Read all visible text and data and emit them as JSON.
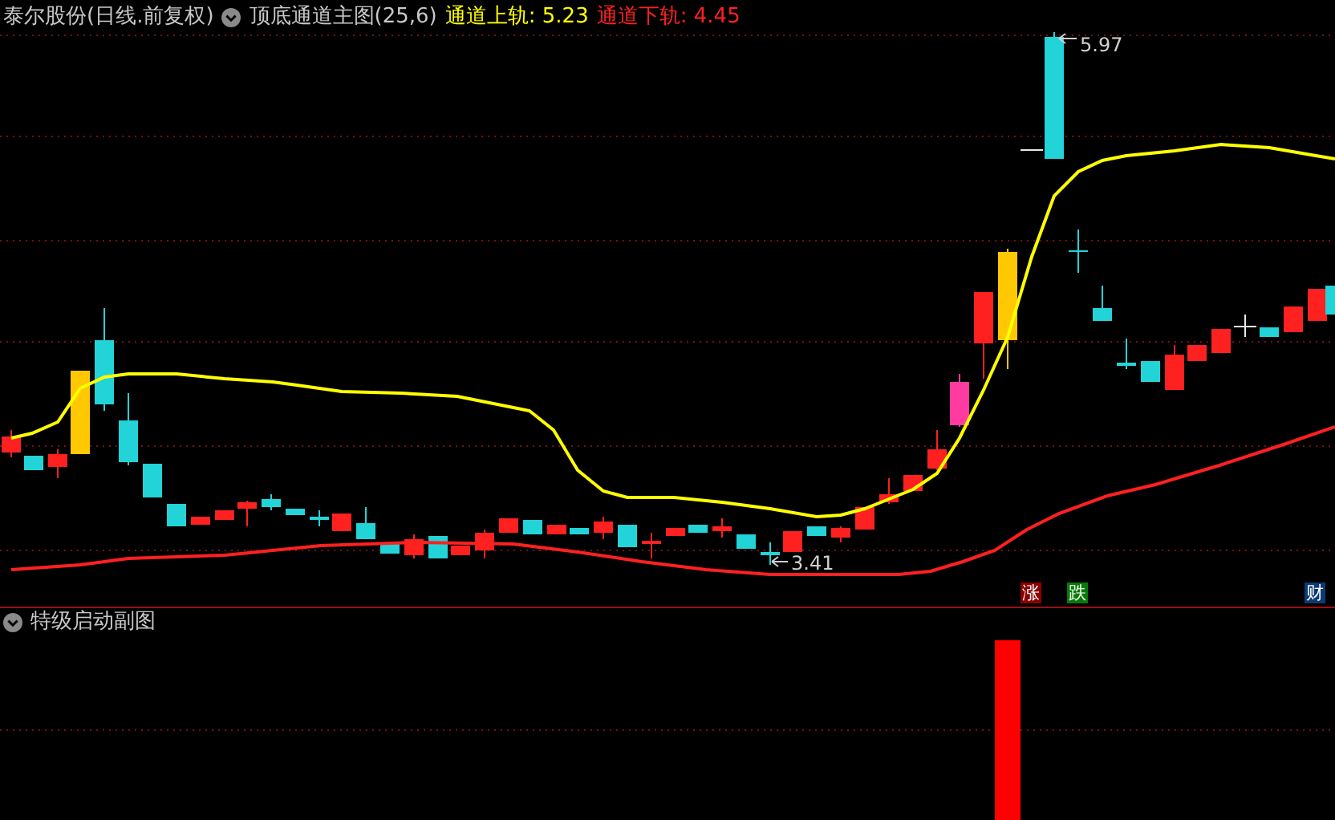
{
  "header": {
    "stock_label": "泰尔股份(日线.前复权)",
    "indicator_name": "顶底通道主图(25,6)",
    "lines": [
      {
        "label": "通道上轨:",
        "value": "5.23",
        "color": "#ffff00"
      },
      {
        "label": "通道下轨:",
        "value": "4.45",
        "color": "#ff2020"
      }
    ]
  },
  "main_chart": {
    "annotations": [
      {
        "text": "5.97",
        "kind": "high"
      },
      {
        "text": "3.41",
        "kind": "low"
      }
    ],
    "markers": [
      {
        "text": "涨",
        "color": "#8b0000"
      },
      {
        "text": "跌",
        "color": "#087a08"
      },
      {
        "text": "财",
        "color": "#0c3a73"
      }
    ]
  },
  "sub_panel": {
    "title": "特级启动副图"
  }
}
